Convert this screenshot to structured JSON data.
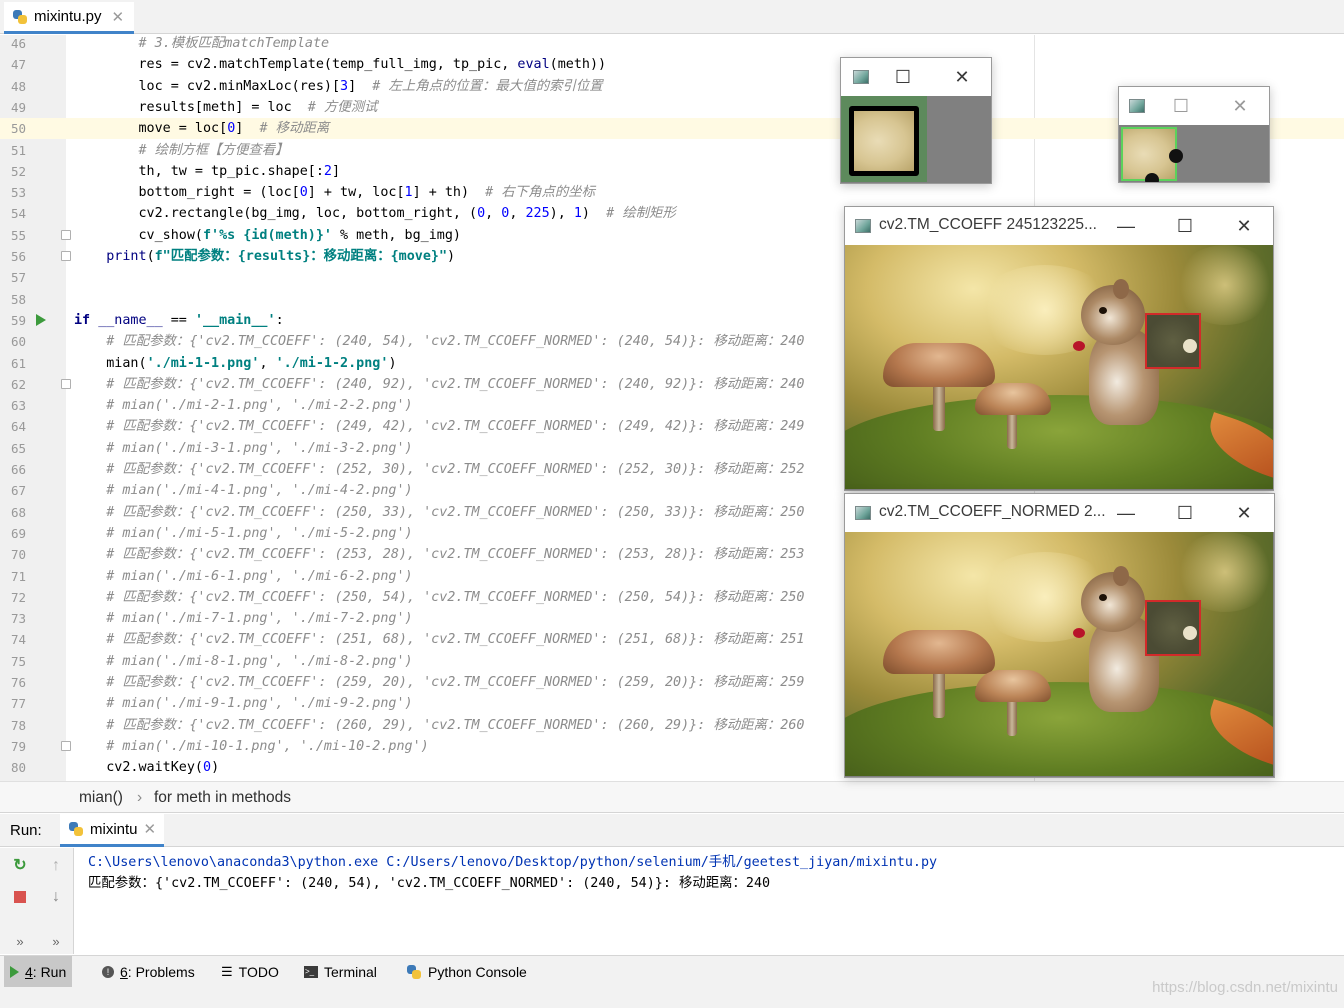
{
  "editor": {
    "tab_label": "mixintu.py",
    "lines": [
      {
        "n": "46",
        "code": "        # 3.模板匹配matchTemplate",
        "style": "cmt"
      },
      {
        "n": "47",
        "code": "        res = cv2.matchTemplate(temp_full_img, tp_pic, eval(meth))"
      },
      {
        "n": "48",
        "code": "        loc = cv2.minMaxLoc(res)[3]  # 左上角点的位置：最大值的索引位置"
      },
      {
        "n": "49",
        "code": "        results[meth] = loc  # 方便测试"
      },
      {
        "n": "50",
        "code": "        move = loc[0]  # 移动距离"
      },
      {
        "n": "51",
        "code": "        # 绘制方框【方便查看】",
        "style": "cmt"
      },
      {
        "n": "52",
        "code": "        th, tw = tp_pic.shape[:2]"
      },
      {
        "n": "53",
        "code": "        bottom_right = (loc[0] + tw, loc[1] + th)  # 右下角点的坐标"
      },
      {
        "n": "54",
        "code": "        cv2.rectangle(bg_img, loc, bottom_right, (0, 0, 225), 1)  # 绘制矩形"
      },
      {
        "n": "55",
        "code": "        cv_show(f'%s {id(meth)}' % meth, bg_img)"
      },
      {
        "n": "56",
        "code": "    print(f\"匹配参数：{results}：移动距离：{move}\")"
      },
      {
        "n": "57",
        "code": ""
      },
      {
        "n": "58",
        "code": ""
      },
      {
        "n": "59",
        "code": "if __name__ == '__main__':"
      },
      {
        "n": "60",
        "code": "    # 匹配参数：{'cv2.TM_CCOEFF': (240, 54), 'cv2.TM_CCOEFF_NORMED': (240, 54)}: 移动距离：240",
        "style": "cmt"
      },
      {
        "n": "61",
        "code": "    mian('./mi-1-1.png', './mi-1-2.png')"
      },
      {
        "n": "62",
        "code": "    # 匹配参数：{'cv2.TM_CCOEFF': (240, 92), 'cv2.TM_CCOEFF_NORMED': (240, 92)}: 移动距离：240",
        "style": "cmt"
      },
      {
        "n": "63",
        "code": "    # mian('./mi-2-1.png', './mi-2-2.png')",
        "style": "cmt"
      },
      {
        "n": "64",
        "code": "    # 匹配参数：{'cv2.TM_CCOEFF': (249, 42), 'cv2.TM_CCOEFF_NORMED': (249, 42)}: 移动距离：249",
        "style": "cmt"
      },
      {
        "n": "65",
        "code": "    # mian('./mi-3-1.png', './mi-3-2.png')",
        "style": "cmt"
      },
      {
        "n": "66",
        "code": "    # 匹配参数：{'cv2.TM_CCOEFF': (252, 30), 'cv2.TM_CCOEFF_NORMED': (252, 30)}: 移动距离：252",
        "style": "cmt"
      },
      {
        "n": "67",
        "code": "    # mian('./mi-4-1.png', './mi-4-2.png')",
        "style": "cmt"
      },
      {
        "n": "68",
        "code": "    # 匹配参数：{'cv2.TM_CCOEFF': (250, 33), 'cv2.TM_CCOEFF_NORMED': (250, 33)}: 移动距离：250",
        "style": "cmt"
      },
      {
        "n": "69",
        "code": "    # mian('./mi-5-1.png', './mi-5-2.png')",
        "style": "cmt"
      },
      {
        "n": "70",
        "code": "    # 匹配参数：{'cv2.TM_CCOEFF': (253, 28), 'cv2.TM_CCOEFF_NORMED': (253, 28)}: 移动距离：253",
        "style": "cmt"
      },
      {
        "n": "71",
        "code": "    # mian('./mi-6-1.png', './mi-6-2.png')",
        "style": "cmt"
      },
      {
        "n": "72",
        "code": "    # 匹配参数：{'cv2.TM_CCOEFF': (250, 54), 'cv2.TM_CCOEFF_NORMED': (250, 54)}: 移动距离：250",
        "style": "cmt"
      },
      {
        "n": "73",
        "code": "    # mian('./mi-7-1.png', './mi-7-2.png')",
        "style": "cmt"
      },
      {
        "n": "74",
        "code": "    # 匹配参数：{'cv2.TM_CCOEFF': (251, 68), 'cv2.TM_CCOEFF_NORMED': (251, 68)}: 移动距离：251",
        "style": "cmt"
      },
      {
        "n": "75",
        "code": "    # mian('./mi-8-1.png', './mi-8-2.png')",
        "style": "cmt"
      },
      {
        "n": "76",
        "code": "    # 匹配参数：{'cv2.TM_CCOEFF': (259, 20), 'cv2.TM_CCOEFF_NORMED': (259, 20)}: 移动距离：259",
        "style": "cmt"
      },
      {
        "n": "77",
        "code": "    # mian('./mi-9-1.png', './mi-9-2.png')",
        "style": "cmt"
      },
      {
        "n": "78",
        "code": "    # 匹配参数：{'cv2.TM_CCOEFF': (260, 29), 'cv2.TM_CCOEFF_NORMED': (260, 29)}: 移动距离：260",
        "style": "cmt"
      },
      {
        "n": "79",
        "code": "    # mian('./mi-10-1.png', './mi-10-2.png')",
        "style": "cmt"
      },
      {
        "n": "80",
        "code": "    cv2.waitKey(0)"
      }
    ]
  },
  "breadcrumb": {
    "first": "mian()",
    "separator": "›",
    "second": "for meth in methods"
  },
  "run_panel": {
    "label": "Run:",
    "tab_label": "mixintu",
    "console_lines": [
      "C:\\Users\\lenovo\\anaconda3\\python.exe C:/Users/lenovo/Desktop/python/selenium/手机/geetest_jiyan/mixintu.py",
      "匹配参数：{'cv2.TM_CCOEFF': (240, 54), 'cv2.TM_CCOEFF_NORMED': (240, 54)}: 移动距离：240"
    ]
  },
  "statusbar": {
    "run_num": "4",
    "run_label": ": Run",
    "problems_num": "6",
    "problems_label": ": Problems",
    "todo": "TODO",
    "terminal": "Terminal",
    "python_console": "Python Console"
  },
  "windows": {
    "ccoeff_title": "cv2.TM_CCOEFF 245123225...",
    "normed_title": "cv2.TM_CCOEFF_NORMED 2..."
  },
  "watermark": "https://blog.csdn.net/mixintu",
  "icons": {
    "minimize": "—",
    "maximize": "☐",
    "close": "✕"
  },
  "colors": {
    "accent": "#4083c9",
    "current_line": "#fffae3",
    "keyword": "#000080",
    "string": "#008080",
    "number": "#0000ff",
    "comment": "#8c8c8c",
    "match_rect": "#d22a2a"
  }
}
